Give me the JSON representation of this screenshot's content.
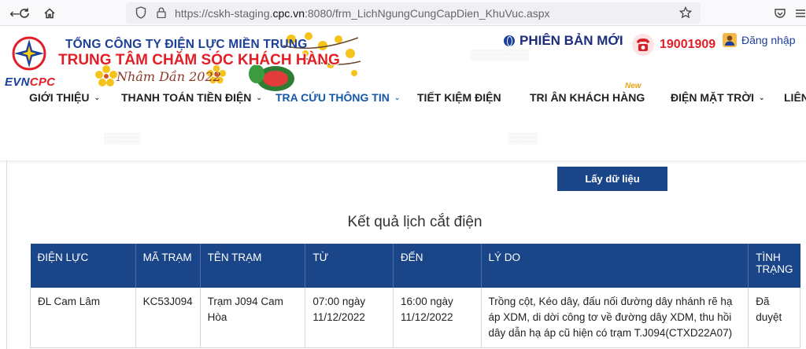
{
  "browser": {
    "url_prefix": "https://cskh-staging.",
    "url_domain": "cpc.vn",
    "url_suffix": ":8080/frm_LichNgungCungCapDien_KhuVuc.aspx"
  },
  "header": {
    "logo_text_blue": "EVN",
    "logo_text_red": "CPC",
    "company_name": "TỔNG CÔNG TY ĐIỆN LỰC MIỀN TRUNG",
    "center_name": "TRUNG TÂM CHĂM SÓC KHÁCH HÀNG",
    "tet_text": "Nhâm Dần 2022",
    "new_version": "PHIÊN BẢN MỚI",
    "hotline": "19001909",
    "login": "Đăng nhập",
    "new_badge": "New"
  },
  "menu": [
    {
      "label": "GIỚI THIỆU",
      "caret": "⌄"
    },
    {
      "label": "THANH TOÁN TIỀN ĐIỆN",
      "caret": "⌄"
    },
    {
      "label": "TRA CỨU THÔNG TIN",
      "caret": "⌄"
    },
    {
      "label": "TIẾT KIỆM ĐIỆN",
      "caret": ""
    },
    {
      "label": "TRI ÂN KHÁCH HÀNG",
      "caret": ""
    },
    {
      "label": "ĐIỆN MẶT TRỜI",
      "caret": "⌄"
    },
    {
      "label": "LIÊN",
      "caret": ""
    }
  ],
  "form": {
    "fetch_button": "Lấy dữ liệu",
    "result_title": "Kết quả lịch cắt điện"
  },
  "table": {
    "headers": [
      "ĐIỆN LỰC",
      "MÃ TRẠM",
      "TÊN TRẠM",
      "TỪ",
      "ĐẾN",
      "LÝ DO",
      "TÌNH TRẠNG"
    ],
    "rows": [
      {
        "dien_luc": "ĐL Cam Lâm",
        "ma_tram": "KC53J094",
        "ten_tram": "Trạm J094 Cam Hòa",
        "tu": "07:00 ngày 11/12/2022",
        "den": "16:00 ngày 11/12/2022",
        "ly_do": "Trồng cột, Kéo dây, đấu nối đường dây nhánh rẽ hạ áp XDM, di dời công tơ về đường dây XDM, thu hồi dây dẫn hạ áp cũ hiện có trạm T.J094(CTXD22A07)",
        "tinh_trang": "Đã duyệt"
      }
    ]
  },
  "colors": {
    "primary_blue": "#1a4588",
    "brand_red": "#e21e26",
    "brand_blue": "#1c3f9a"
  }
}
